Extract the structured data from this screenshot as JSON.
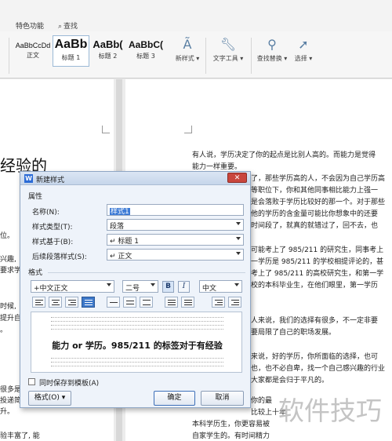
{
  "ribbon": {
    "tabs": {
      "special": "特色功能",
      "search": "查找",
      "search_icon": "search-icon"
    },
    "styles": [
      {
        "sample": "AaBbCcDd",
        "label": "正文"
      },
      {
        "sample": "AaBb",
        "label": "标题 1"
      },
      {
        "sample": "AaBb(",
        "label": "标题 2"
      },
      {
        "sample": "AaBbC(",
        "label": "标题 3"
      }
    ],
    "tools": {
      "new_style": "新样式",
      "text_tools": "文字工具",
      "find_replace": "查找替换",
      "select": "选择"
    }
  },
  "document": {
    "left_title": "经验的",
    "left_lines": [
      "位。",
      "兴趣,",
      "要求学",
      "时候,",
      "提升自",
      "。",
      "很多是",
      "投递简",
      "升。",
      "验丰富了, 能"
    ],
    "right_lines": [
      "有人说，学历决定了你的起点是比别人高的。而能力是觉得",
      "能力一样重要。",
      "了，那些学历高的人，不会因为自己学历高",
      "等职位下，你和其他同事相比能力上强一",
      "是会落败于学历比较好的那一个。对于那些",
      "他的学历的含金量可能比你想象中的还要",
      "时间段了，就真的就错过了，回不去，也",
      "可能考上了 985/211 的研究生，同事考上",
      "一学历是 985/211 的学校相提评论的，甚",
      "考上了 985/211 的高校研究生，和第一学",
      "校的本科毕业生，在他们眼里，第一学历",
      "人来说，我们的选择有很多，不一定非要",
      "要局限了自己的职场发展。",
      "来说，好的学历，你所面临的选择，也可",
      "也，也不必自卑，找一个自己感兴趣的行业",
      "大家都是会归于平凡的。",
      "你的最",
      "比较上十年",
      "本科学历生，你更容易被",
      "自家学生的。有时间精力"
    ]
  },
  "dialog": {
    "title": "新建样式",
    "properties_label": "属性",
    "name_label": "名称(N):",
    "name_value": "样式1",
    "type_label": "样式类型(T):",
    "type_value": "段落",
    "based_label": "样式基于(B):",
    "based_value": "↵ 标题 1",
    "next_label": "后续段落样式(S):",
    "next_value": "↵ 正文",
    "format_label": "格式",
    "font_value": "+中文正文",
    "size_value": "二号",
    "bold": "B",
    "italic": "I",
    "lang_value": "中文",
    "preview_text": "能力 or 学历。985/211 的标签对于有经验",
    "template_checkbox": "同时保存到模板(A)",
    "format_button": "格式(O)",
    "ok_button": "确定",
    "cancel_button": "取消"
  },
  "watermark": "软件技巧"
}
